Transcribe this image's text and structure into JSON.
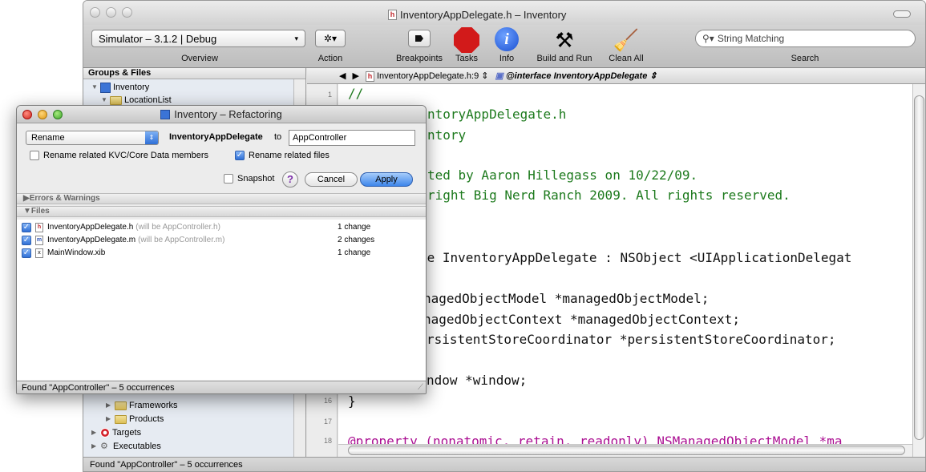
{
  "window": {
    "title": "InventoryAppDelegate.h – Inventory",
    "file_icon_letter": "h"
  },
  "toolbar": {
    "scheme": "Simulator – 3.1.2 | Debug",
    "overview_label": "Overview",
    "action_label": "Action",
    "breakpoints_label": "Breakpoints",
    "tasks_label": "Tasks",
    "info_label": "Info",
    "build_run_label": "Build and Run",
    "clean_all_label": "Clean All",
    "search_placeholder": "String Matching",
    "search_label": "Search"
  },
  "sidebar": {
    "header": "Groups & Files",
    "items": [
      {
        "label": "Inventory"
      },
      {
        "label": "LocationList"
      },
      {
        "label": "Frameworks"
      },
      {
        "label": "Products"
      },
      {
        "label": "Targets"
      },
      {
        "label": "Executables"
      }
    ]
  },
  "editor": {
    "nav_file": "InventoryAppDelegate.h:9",
    "nav_symbol": "@interface InventoryAppDelegate",
    "line_numbers": [
      "1",
      "16",
      "17",
      "18"
    ],
    "lines": [
      "//",
      "ntoryAppDelegate.h",
      "ntory",
      "ted by Aaron Hillegass on 10/22/09.",
      "right Big Nerd Ranch 2009. All rights reserved.",
      "ce InventoryAppDelegate : NSObject <UIApplicationDelegat",
      "nagedObjectModel *managedObjectModel;",
      "nagedObjectContext *managedObjectContext;",
      "rsistentStoreCoordinator *persistentStoreCoordinator;",
      "ndow *window;",
      "}",
      "@property (nonatomic, retain, readonly) NSManagedObjectModel *ma"
    ]
  },
  "status": {
    "text": "Found \"AppController\" – 5 occurrences"
  },
  "dialog": {
    "title": "Inventory – Refactoring",
    "operation": "Rename",
    "old_name": "InventoryAppDelegate",
    "to_label": "to",
    "new_name": "AppController",
    "opt_kvc": "Rename related KVC/Core Data members",
    "opt_files": "Rename related files",
    "snapshot_label": "Snapshot",
    "help_label": "?",
    "cancel_label": "Cancel",
    "apply_label": "Apply",
    "errors_section": "Errors & Warnings",
    "files_section": "Files",
    "files": [
      {
        "name": "InventoryAppDelegate.h",
        "note": "(will be AppController.h)",
        "changes": "1 change",
        "icon": "h"
      },
      {
        "name": "InventoryAppDelegate.m",
        "note": "(will be AppController.m)",
        "changes": "2 changes",
        "icon": "m"
      },
      {
        "name": "MainWindow.xib",
        "note": "",
        "changes": "1 change",
        "icon": "x"
      }
    ],
    "status": "Found \"AppController\" – 5 occurrences"
  }
}
